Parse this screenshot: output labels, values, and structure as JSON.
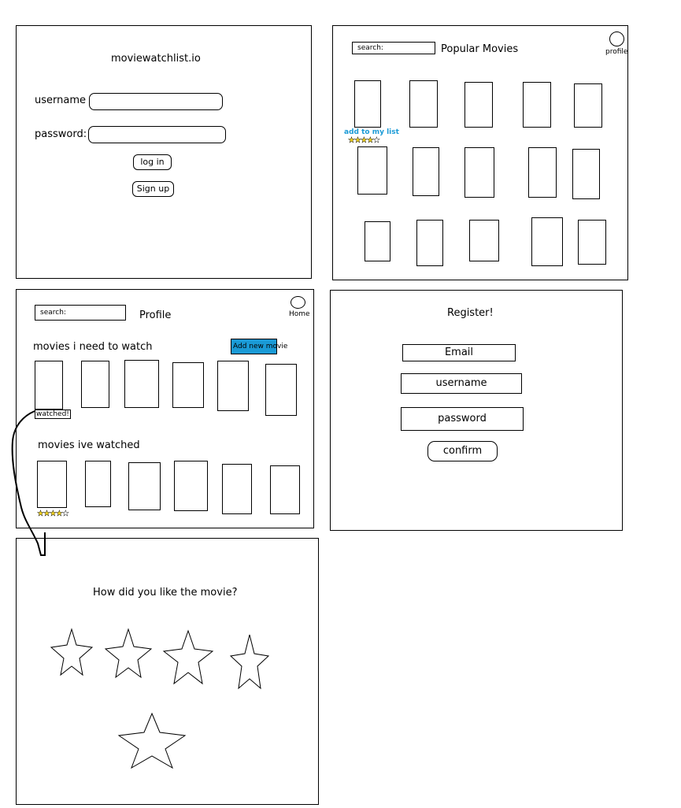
{
  "login": {
    "title": "moviewatchlist.io",
    "username_label": "username",
    "password_label": "password:",
    "login_button": "log in",
    "signup_button": "Sign up"
  },
  "popular": {
    "search_placeholder": "search:",
    "title": "Popular Movies",
    "profile_label": "profile",
    "add_to_list": "add to my list",
    "rating_stars": "★★★★☆"
  },
  "profile": {
    "search_placeholder": "search:",
    "title": "Profile",
    "home_label": "Home",
    "need_to_watch_heading": "movies i need to watch",
    "add_new_movie": "Add new movie",
    "watched_label": "watched!",
    "watched_heading": "movies ive watched",
    "rating_stars": "★★★★☆"
  },
  "register": {
    "title": "Register!",
    "email": "Email",
    "username": "username",
    "password": "password",
    "confirm": "confirm"
  },
  "rating": {
    "question": "How did you like the movie?"
  },
  "colors": {
    "accent_blue": "#1a9ad6",
    "star_yellow": "#f2d21b"
  }
}
